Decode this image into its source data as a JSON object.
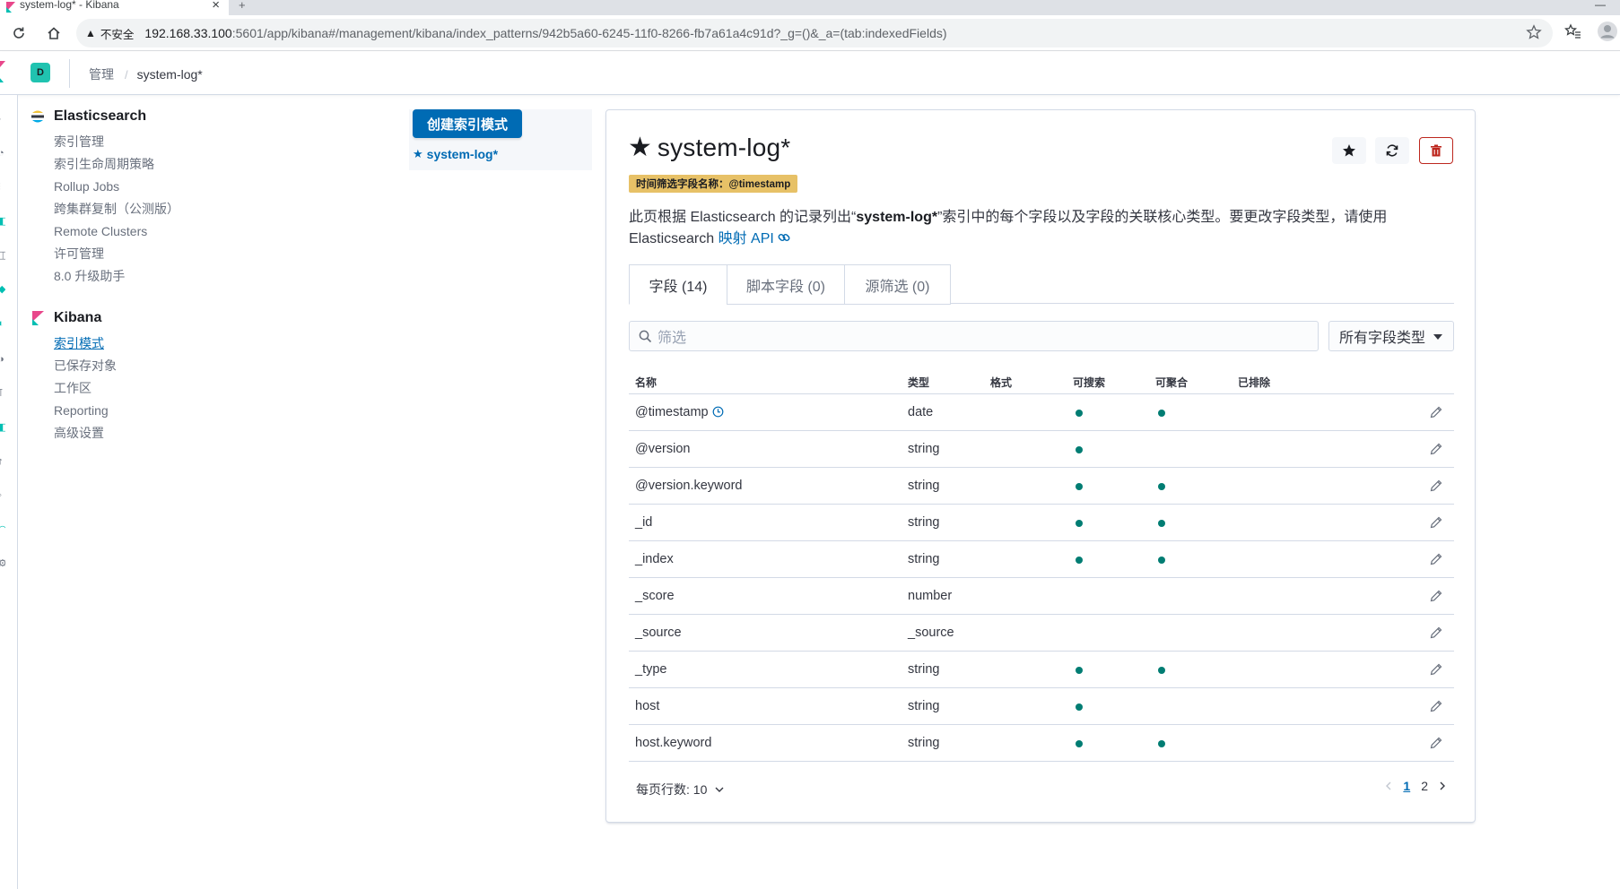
{
  "browser": {
    "tab_title": "system-log* - Kibana",
    "tab_close": "×",
    "new_tab": "+",
    "security_label": "不安全",
    "url_host": "192.168.33.100",
    "url_rest": ":5601/app/kibana#/management/kibana/index_patterns/942b5a60-6245-11f0-8266-fb7a61a4c91d?_g=()&_a=(tab:indexedFields)"
  },
  "header": {
    "space_initial": "D",
    "breadcrumbs": {
      "parent": "管理",
      "current": "system-log*"
    }
  },
  "sidebar": {
    "elasticsearch": {
      "title": "Elasticsearch",
      "items": [
        "索引管理",
        "索引生命周期策略",
        "Rollup Jobs",
        "跨集群复制（公测版）",
        "Remote Clusters",
        "许可管理",
        "8.0 升级助手"
      ]
    },
    "kibana": {
      "title": "Kibana",
      "items": [
        "索引模式",
        "已保存对象",
        "工作区",
        "Reporting",
        "高级设置"
      ]
    }
  },
  "index_patterns": {
    "create_button": "创建索引模式",
    "items": [
      "system-log*"
    ]
  },
  "panel": {
    "title": "system-log*",
    "time_badge": "时间筛选字段名称：@timestamp",
    "desc_before": "此页根据 Elasticsearch 的记录列出“",
    "desc_bold": "system-log*",
    "desc_after": "”索引中的每个字段以及字段的关联核心类型。要更改字段类型，请使用 Elasticsearch ",
    "desc_link": "映射 API",
    "tabs": [
      "字段 (14)",
      "脚本字段 (0)",
      "源筛选 (0)"
    ],
    "search_placeholder": "筛选",
    "type_filter": "所有字段类型",
    "columns": [
      "名称",
      "类型",
      "格式",
      "可搜索",
      "可聚合",
      "已排除"
    ],
    "rows": [
      {
        "name": "@timestamp",
        "type": "date",
        "searchable": true,
        "aggregatable": true,
        "time": true
      },
      {
        "name": "@version",
        "type": "string",
        "searchable": true,
        "aggregatable": false
      },
      {
        "name": "@version.keyword",
        "type": "string",
        "searchable": true,
        "aggregatable": true
      },
      {
        "name": "_id",
        "type": "string",
        "searchable": true,
        "aggregatable": true
      },
      {
        "name": "_index",
        "type": "string",
        "searchable": true,
        "aggregatable": true
      },
      {
        "name": "_score",
        "type": "number",
        "searchable": false,
        "aggregatable": false
      },
      {
        "name": "_source",
        "type": "_source",
        "searchable": false,
        "aggregatable": false
      },
      {
        "name": "_type",
        "type": "string",
        "searchable": true,
        "aggregatable": true
      },
      {
        "name": "host",
        "type": "string",
        "searchable": true,
        "aggregatable": false
      },
      {
        "name": "host.keyword",
        "type": "string",
        "searchable": true,
        "aggregatable": true
      }
    ],
    "rows_per_page": "每页行数: 10",
    "pages": [
      "1",
      "2"
    ],
    "current_page": "1"
  },
  "colors": {
    "primary": "#006bb4",
    "success_dot": "#017d73",
    "badge": "#e7c167",
    "danger": "#bd271e",
    "space": "#20c3b0"
  }
}
